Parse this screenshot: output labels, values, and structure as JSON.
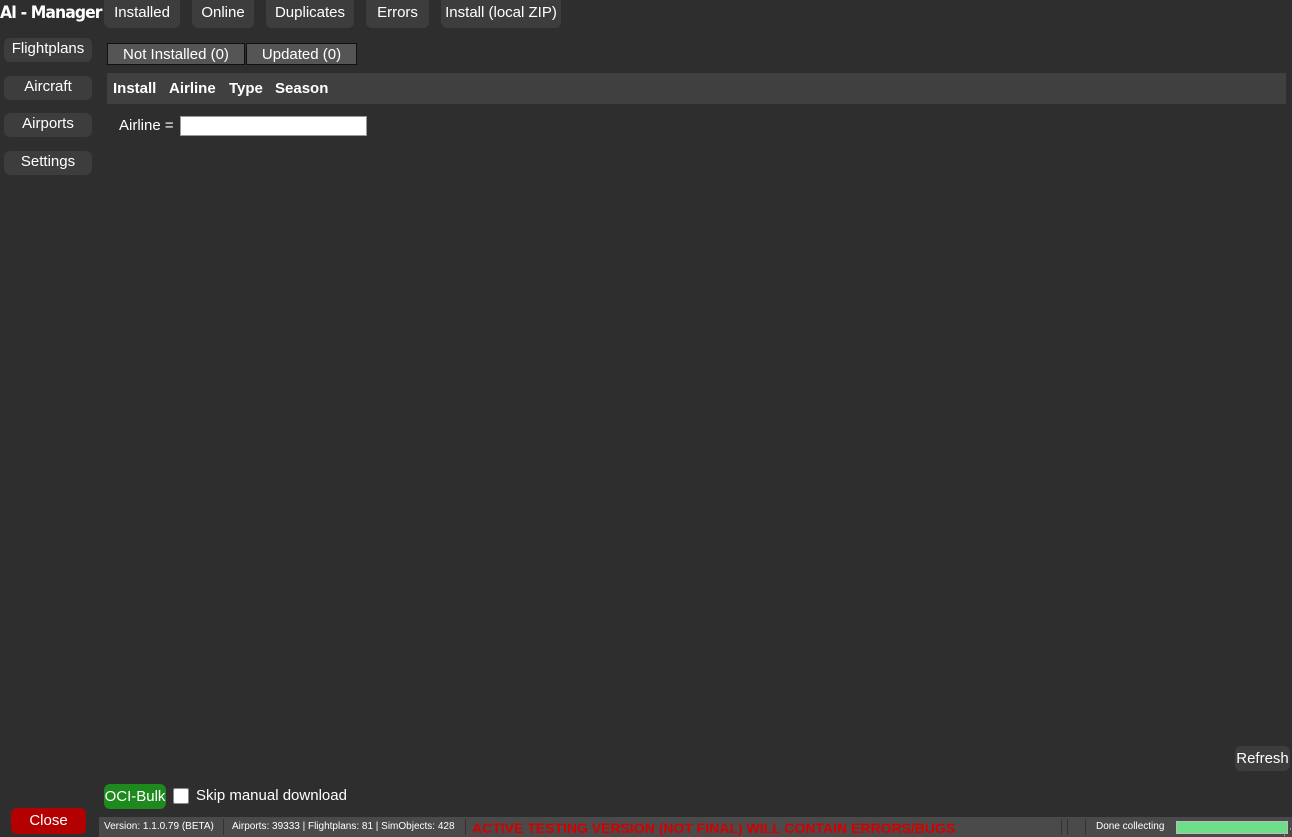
{
  "app": {
    "title": "AI - Manager"
  },
  "top_tabs": [
    {
      "label": "Installed"
    },
    {
      "label": "Online"
    },
    {
      "label": "Duplicates"
    },
    {
      "label": "Errors"
    },
    {
      "label": "Install (local ZIP)"
    }
  ],
  "sidebar": {
    "items": [
      {
        "label": "Flightplans"
      },
      {
        "label": "Aircraft"
      },
      {
        "label": "Airports"
      },
      {
        "label": "Settings"
      }
    ]
  },
  "sub_tabs": [
    {
      "label": "Not Installed (0)"
    },
    {
      "label": "Updated (0)"
    }
  ],
  "table": {
    "columns": [
      "Install",
      "Airline",
      "Type",
      "Season"
    ]
  },
  "filter": {
    "label": "Airline =",
    "value": ""
  },
  "actions": {
    "refresh_label": "Refresh",
    "oci_bulk_label": "OCI-Bulk",
    "skip_manual_download_label": "Skip manual download",
    "skip_manual_download_checked": false,
    "close_label": "Close"
  },
  "status_bar": {
    "version": "Version: 1.1.0.79 (BETA)",
    "stats": "Airports: 39333 | Flightplans: 81 | SimObjects: 428",
    "warning": "ACTIVE TESTING VERSION (NOT FINAL) WILL CONTAIN ERRORS/BUGS",
    "status": "Done collecting",
    "progress": 1.0
  },
  "colors": {
    "background": "#2e2e2e",
    "button": "#3d3d3d",
    "close_button": "#b30000",
    "oci_button": "#1e8a1e",
    "warning_text": "#d40000",
    "progress_fill": "#6cdf88"
  }
}
